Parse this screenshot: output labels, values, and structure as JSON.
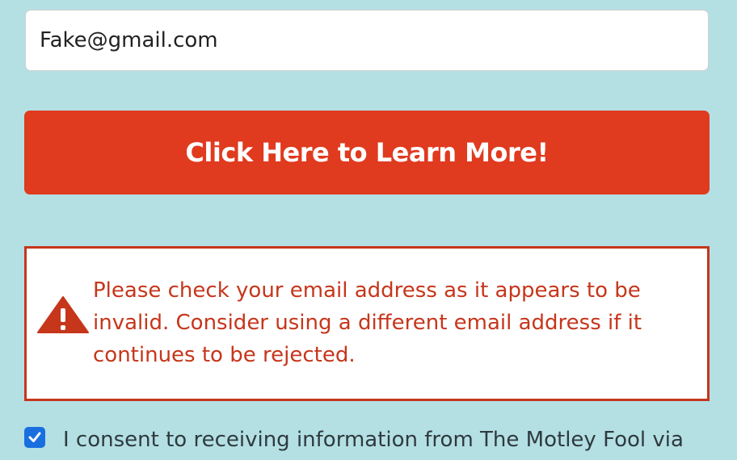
{
  "form": {
    "email_value": "Fake@gmail.com",
    "submit_label": "Click Here to Learn More!"
  },
  "error": {
    "icon": "warning-icon",
    "message": "Please check your email address as it appears to be invalid. Consider using a different email address if it continues to be rejected."
  },
  "consent": {
    "checked": true,
    "text": "I consent to receiving information from The Motley Fool via"
  },
  "colors": {
    "page_background": "#b4e0e4",
    "button_background": "#e03a1f",
    "error_color": "#c6361b",
    "checkbox_color": "#1a6fe0"
  }
}
